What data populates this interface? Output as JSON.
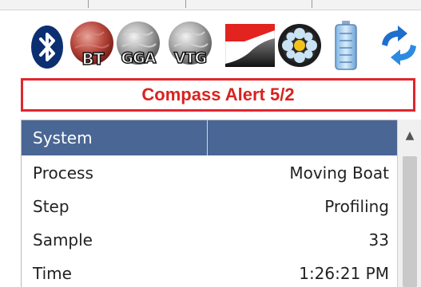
{
  "icons": [
    {
      "name": "bluetooth-icon",
      "label": ""
    },
    {
      "name": "bt-globe-icon",
      "label": "BT"
    },
    {
      "name": "gga-globe-icon",
      "label": "GGA"
    },
    {
      "name": "vtg-globe-icon",
      "label": "VTG"
    },
    {
      "name": "depth-profile-icon",
      "label": ""
    },
    {
      "name": "film-reel-icon",
      "label": ""
    },
    {
      "name": "battery-icon",
      "label": ""
    },
    {
      "name": "refresh-icon",
      "label": ""
    }
  ],
  "alert": {
    "text": "Compass Alert 5/2",
    "color": "#e0262c"
  },
  "table": {
    "header": {
      "col1": "System",
      "col2": ""
    },
    "rows": [
      {
        "key": "Process",
        "value": "Moving Boat"
      },
      {
        "key": "Step",
        "value": "Profiling"
      },
      {
        "key": "Sample",
        "value": "33"
      },
      {
        "key": "Time",
        "value": "1:26:21 PM"
      }
    ]
  },
  "colors": {
    "header_bg": "#4a6694",
    "alert_red": "#d8231f"
  }
}
